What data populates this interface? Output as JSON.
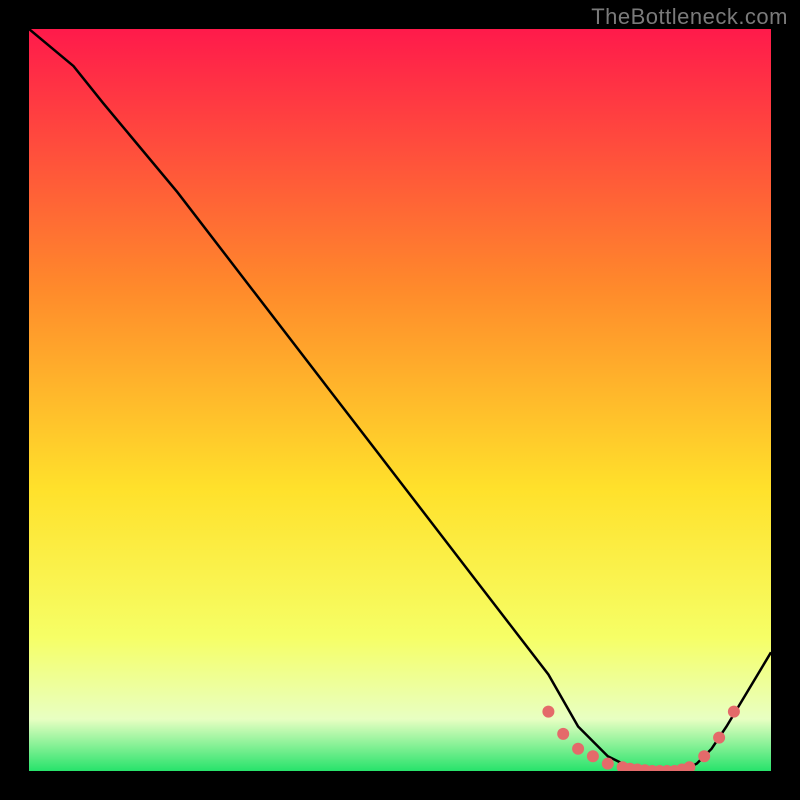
{
  "watermark": "TheBottleneck.com",
  "colors": {
    "gradient_top": "#ff1a4b",
    "gradient_mid1": "#ff8a2b",
    "gradient_mid2": "#ffe12b",
    "gradient_mid3": "#f6ff66",
    "gradient_low": "#e8ffc2",
    "gradient_bottom": "#27e36b",
    "curve": "#000000",
    "marker": "#e46a6a"
  },
  "chart_data": {
    "type": "line",
    "title": "",
    "xlabel": "",
    "ylabel": "",
    "xlim": [
      0,
      100
    ],
    "ylim": [
      0,
      100
    ],
    "series": [
      {
        "name": "bottleneck-curve",
        "x": [
          0,
          6,
          10,
          20,
          30,
          40,
          50,
          60,
          70,
          74,
          78,
          82,
          86,
          88,
          90,
          92,
          94,
          100
        ],
        "y": [
          100,
          95,
          90,
          78,
          65,
          52,
          39,
          26,
          13,
          6,
          2,
          0,
          0,
          0,
          1,
          3,
          6,
          16
        ]
      }
    ],
    "markers": {
      "name": "highlight-dots",
      "x": [
        70,
        72,
        74,
        76,
        78,
        80,
        81,
        82,
        83,
        84,
        85,
        86,
        87,
        88,
        89,
        91,
        93,
        95
      ],
      "y": [
        8,
        5,
        3,
        2,
        1,
        0.5,
        0.3,
        0.2,
        0.1,
        0,
        0,
        0,
        0,
        0.2,
        0.5,
        2,
        4.5,
        8
      ]
    }
  }
}
